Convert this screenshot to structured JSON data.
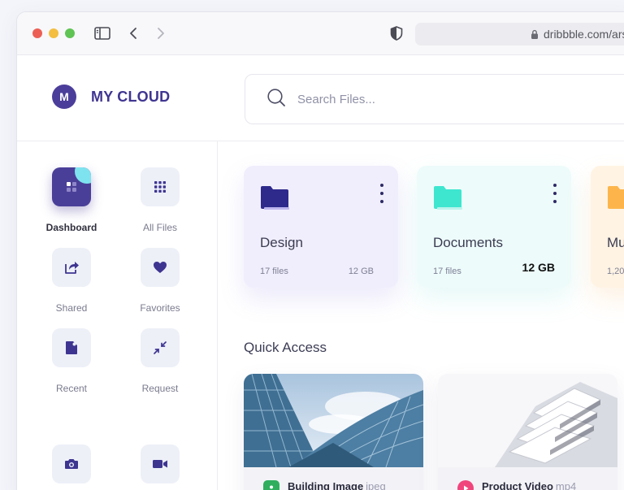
{
  "browser": {
    "url": "dribbble.com/ars"
  },
  "app": {
    "avatar_initial": "M",
    "brand_name": "MY CLOUD"
  },
  "search": {
    "placeholder": "Search Files..."
  },
  "sidebar": {
    "items": [
      {
        "label": "Dashboard",
        "icon": "dashboard-icon",
        "active": true
      },
      {
        "label": "All Files",
        "icon": "grid-icon",
        "active": false
      },
      {
        "label": "Shared",
        "icon": "share-icon",
        "active": false
      },
      {
        "label": "Favorites",
        "icon": "heart-icon",
        "active": false
      },
      {
        "label": "Recent",
        "icon": "recent-icon",
        "active": false
      },
      {
        "label": "Request",
        "icon": "request-icon",
        "active": false
      },
      {
        "label": "",
        "icon": "camera-icon",
        "active": false
      },
      {
        "label": "",
        "icon": "video-icon",
        "active": false
      }
    ]
  },
  "folders": [
    {
      "name": "Design",
      "count": "17 files",
      "size": "12 GB",
      "color": "#2e2a8c"
    },
    {
      "name": "Documents",
      "count": "17 files",
      "size": "12 GB",
      "color": "#3ee6cf"
    },
    {
      "name": "Mu",
      "count": "1,20",
      "size": "",
      "color": "#fdb54b"
    }
  ],
  "quick_access": {
    "title": "Quick Access",
    "files": [
      {
        "name": "Building Image",
        "ext": "jpeg",
        "type_icon": "image-file-icon",
        "color": "#2fae5e"
      },
      {
        "name": "Product Video",
        "ext": "mp4",
        "type_icon": "play-file-icon",
        "color": "#f0457c"
      }
    ]
  },
  "colors": {
    "accent": "#4a3f98",
    "active_corner": "#7ee3ef"
  }
}
